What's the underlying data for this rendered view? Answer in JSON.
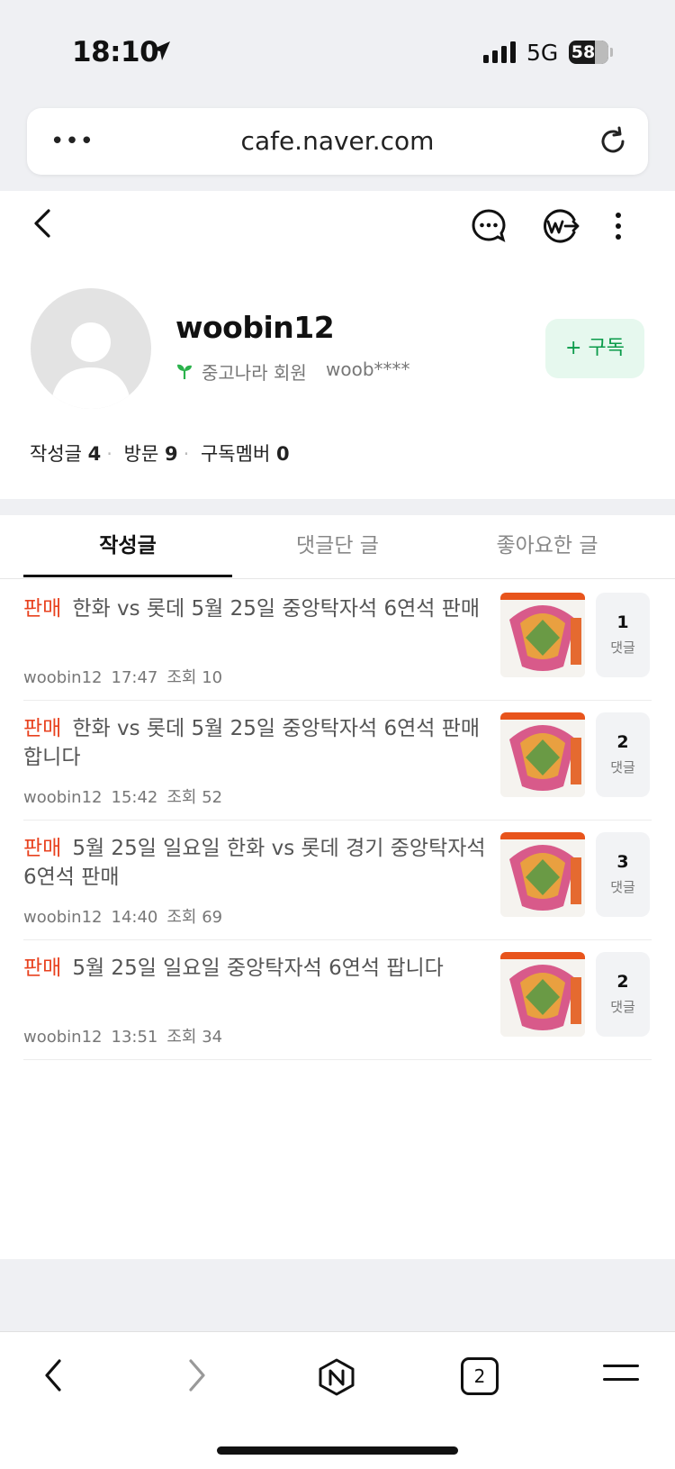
{
  "status": {
    "time": "18:10",
    "network": "5G",
    "battery": "58"
  },
  "urlbar": {
    "url": "cafe.naver.com"
  },
  "profile": {
    "nickname": "woobin12",
    "grade": "중고나라 회원",
    "masked_id": "woob****",
    "subscribe_label": "+ 구독",
    "stats": [
      {
        "label": "작성글",
        "value": "4"
      },
      {
        "label": "방문",
        "value": "9"
      },
      {
        "label": "구독멤버",
        "value": "0"
      }
    ]
  },
  "tabs": [
    {
      "label": "작성글",
      "active": true
    },
    {
      "label": "댓글단 글",
      "active": false
    },
    {
      "label": "좋아요한 글",
      "active": false
    }
  ],
  "posts": [
    {
      "tag": "판매",
      "title": "한화 vs 롯데 5월 25일 중앙탁자석 6연석 판매",
      "author": "woobin12",
      "time": "17:47",
      "views": "조회 10",
      "comments": "1",
      "comments_label": "댓글"
    },
    {
      "tag": "판매",
      "title": "한화 vs 롯데 5월 25일 중앙탁자석 6연석 판매 합니다",
      "author": "woobin12",
      "time": "15:42",
      "views": "조회 52",
      "comments": "2",
      "comments_label": "댓글"
    },
    {
      "tag": "판매",
      "title": "5월 25일 일요일 한화 vs 롯데 경기 중앙탁자석 6연석 판매",
      "author": "woobin12",
      "time": "14:40",
      "views": "조회 69",
      "comments": "3",
      "comments_label": "댓글"
    },
    {
      "tag": "판매",
      "title": "5월 25일 일요일 중앙탁자석 6연석 팝니다",
      "author": "woobin12",
      "time": "13:51",
      "views": "조회 34",
      "comments": "2",
      "comments_label": "댓글"
    }
  ],
  "toolbar": {
    "tab_count": "2"
  },
  "colors": {
    "accent_green": "#0b9b4a",
    "sale_tag": "#e8421f"
  }
}
